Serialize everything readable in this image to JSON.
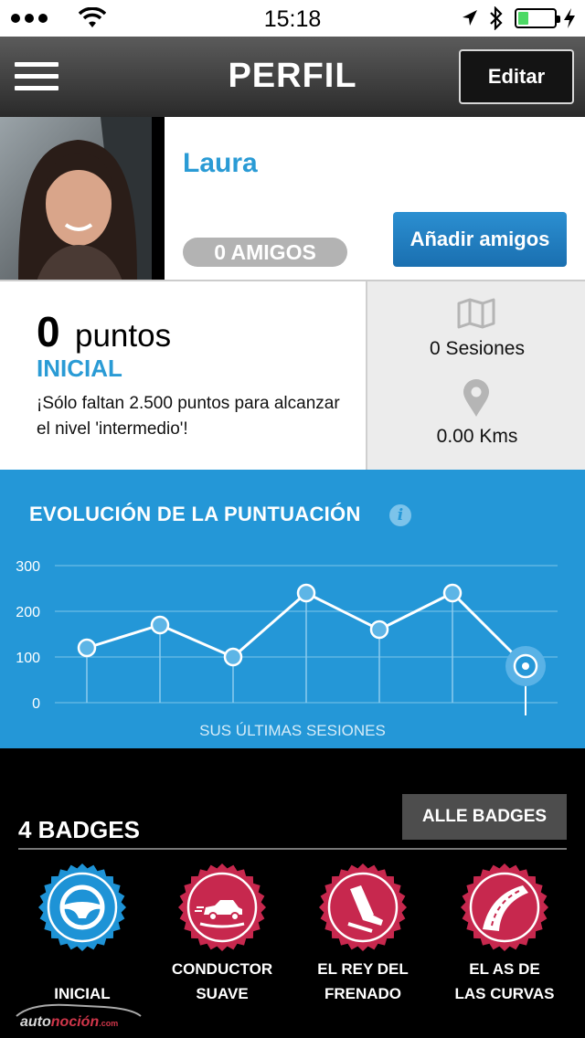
{
  "status_bar": {
    "time": "15:18",
    "battery_level": 0.3,
    "battery_color": "#4cd964"
  },
  "nav": {
    "title": "PERFIL",
    "edit_label": "Editar"
  },
  "profile": {
    "name": "Laura",
    "friends_label": "0 AMIGOS",
    "add_friends_label": "Añadir amigos"
  },
  "stats": {
    "points_value": "0",
    "points_unit": "puntos",
    "level": "INICIAL",
    "message": "¡Sólo faltan 2.500 puntos para alcanzar el nivel 'intermedio'!",
    "sessions": "0 Sesiones",
    "distance": "0.00 Kms"
  },
  "chart_data": {
    "type": "line",
    "title": "EVOLUCIÓN DE LA PUNTUACIÓN",
    "xlabel": "SUS ÚLTIMAS SESIONES",
    "ylabel": "",
    "yticks": [
      "300",
      "200",
      "100",
      "0"
    ],
    "ylim": [
      0,
      300
    ],
    "grid": true,
    "values": [
      120,
      170,
      100,
      240,
      160,
      240,
      80
    ],
    "highlight_last": true
  },
  "badges": {
    "heading": "4 BADGES",
    "all_label": "ALLE BADGES",
    "items": [
      {
        "label_line1": "",
        "label_line2": "INICIAL",
        "icon": "steering-wheel-icon",
        "color": "#1e93d6"
      },
      {
        "label_line1": "CONDUCTOR",
        "label_line2": "SUAVE",
        "icon": "car-icon",
        "color": "#c7284e"
      },
      {
        "label_line1": "EL REY DEL",
        "label_line2": "FRENADO",
        "icon": "brake-pedal-icon",
        "color": "#c7284e"
      },
      {
        "label_line1": "EL AS DE",
        "label_line2": "LAS CURVAS",
        "icon": "curved-road-icon",
        "color": "#c7284e"
      }
    ]
  },
  "watermark": {
    "text_a": "auto",
    "text_b": "noción",
    "tld": ".com"
  },
  "colors": {
    "accent": "#2497d7",
    "link_blue": "#2a9bd5",
    "badge_red": "#c7284e"
  }
}
